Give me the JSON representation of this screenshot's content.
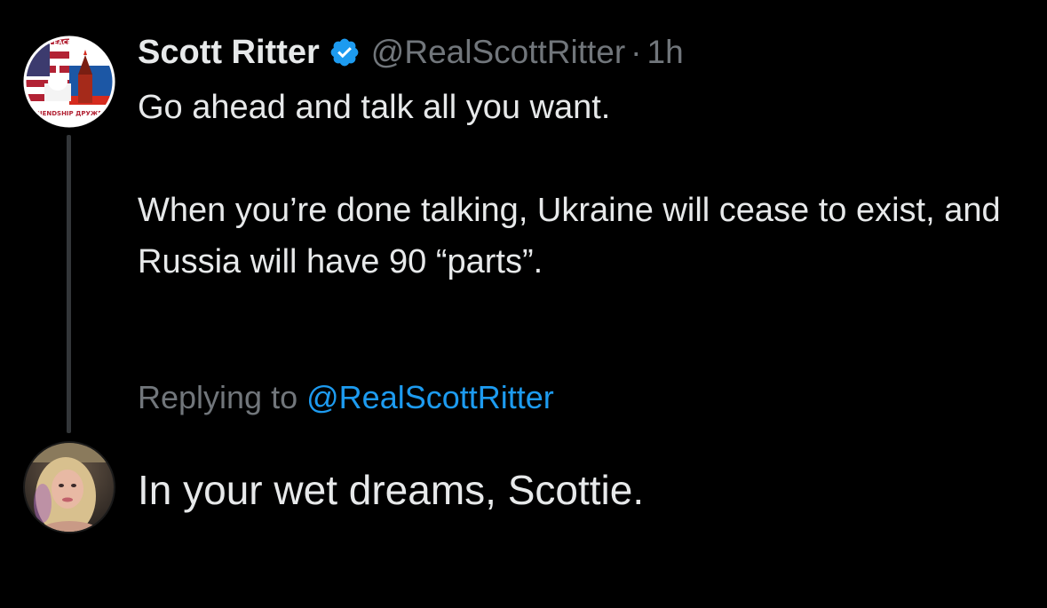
{
  "tweet": {
    "author_name": "Scott Ritter",
    "handle": "@RealScottRitter",
    "separator": "·",
    "time": "1h",
    "verified_icon": "verified-badge-icon",
    "avatar_text": {
      "top": "PEACE МИР",
      "bottom": "FRIENDSHIP ДРУЖБА"
    },
    "paragraphs": [
      "Go ahead and talk all you want.",
      "When you’re done talking, Ukraine will cease to exist, and Russia will have 90 “parts”."
    ]
  },
  "reply": {
    "replying_prefix": "Replying to",
    "replying_handle": "@RealScottRitter",
    "text": "In your wet dreams, Scottie."
  },
  "colors": {
    "background": "#000000",
    "text": "#e7e9ea",
    "muted": "#71767b",
    "accent": "#1d9bf0",
    "thread_line": "#333639"
  }
}
